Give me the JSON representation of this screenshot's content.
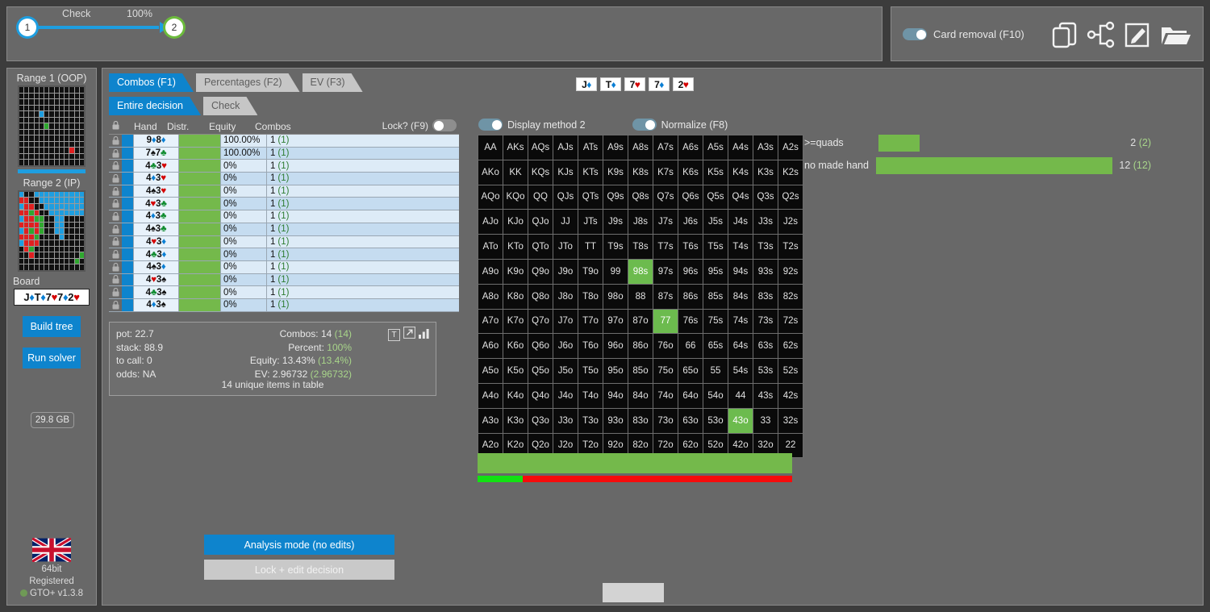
{
  "tree": {
    "node1": "1",
    "node2": "2",
    "action_label": "Check",
    "action_pct": "100%"
  },
  "top_right": {
    "card_removal_label": "Card removal (F10)",
    "card_removal_on": true,
    "icons": [
      "copy-cards-icon",
      "tree-nodes-icon",
      "edit-icon",
      "folder-open-icon"
    ]
  },
  "sidebar": {
    "range1_label": "Range 1 (OOP)",
    "range2_label": "Range 2 (IP)",
    "board_label": "Board",
    "board_value": "J♦T♦7♥7♦2♥",
    "build_tree_label": "Build tree",
    "run_solver_label": "Run solver",
    "memory": "29.8 GB",
    "bits": "64bit",
    "registration": "Registered",
    "version": "GTO+ v1.3.8"
  },
  "tabs_primary": [
    {
      "label": "Combos (F1)",
      "active": true
    },
    {
      "label": "Percentages (F2)",
      "active": false
    },
    {
      "label": "EV (F3)",
      "active": false
    }
  ],
  "tabs_secondary": [
    {
      "label": "Entire decision",
      "active": true
    },
    {
      "label": "Check",
      "active": false
    }
  ],
  "board_cards": [
    {
      "rank": "J",
      "suit": "♦",
      "color": "#0b7fd4"
    },
    {
      "rank": "T",
      "suit": "♦",
      "color": "#0b7fd4"
    },
    {
      "rank": "7",
      "suit": "♥",
      "color": "#d40000"
    },
    {
      "rank": "7",
      "suit": "♦",
      "color": "#0b7fd4"
    },
    {
      "rank": "2",
      "suit": "♥",
      "color": "#d40000"
    }
  ],
  "hand_table": {
    "headers": {
      "hand": "Hand",
      "distr": "Distr.",
      "equity": "Equity",
      "combos": "Combos",
      "lock": "Lock? (F9)"
    },
    "lock_on": false,
    "rows": [
      {
        "hand": "9♦8♦",
        "equity": "100.00%",
        "combos": "1",
        "combos_paren": "(1)"
      },
      {
        "hand": "7♠7♣",
        "equity": "100.00%",
        "combos": "1",
        "combos_paren": "(1)"
      },
      {
        "hand": "4♣3♥",
        "equity": "0%",
        "combos": "1",
        "combos_paren": "(1)"
      },
      {
        "hand": "4♦3♥",
        "equity": "0%",
        "combos": "1",
        "combos_paren": "(1)"
      },
      {
        "hand": "4♠3♥",
        "equity": "0%",
        "combos": "1",
        "combos_paren": "(1)"
      },
      {
        "hand": "4♥3♣",
        "equity": "0%",
        "combos": "1",
        "combos_paren": "(1)"
      },
      {
        "hand": "4♦3♣",
        "equity": "0%",
        "combos": "1",
        "combos_paren": "(1)"
      },
      {
        "hand": "4♠3♣",
        "equity": "0%",
        "combos": "1",
        "combos_paren": "(1)"
      },
      {
        "hand": "4♥3♦",
        "equity": "0%",
        "combos": "1",
        "combos_paren": "(1)"
      },
      {
        "hand": "4♣3♦",
        "equity": "0%",
        "combos": "1",
        "combos_paren": "(1)"
      },
      {
        "hand": "4♠3♦",
        "equity": "0%",
        "combos": "1",
        "combos_paren": "(1)"
      },
      {
        "hand": "4♥3♠",
        "equity": "0%",
        "combos": "1",
        "combos_paren": "(1)"
      },
      {
        "hand": "4♣3♠",
        "equity": "0%",
        "combos": "1",
        "combos_paren": "(1)"
      },
      {
        "hand": "4♦3♠",
        "equity": "0%",
        "combos": "1",
        "combos_paren": "(1)"
      }
    ]
  },
  "info": {
    "pot_label": "pot:",
    "pot_value": "22.7",
    "stack_label": "stack:",
    "stack_value": "88.9",
    "tocall_label": "to call:",
    "tocall_value": "0",
    "odds_label": "odds:",
    "odds_value": "NA",
    "combos_label": "Combos:",
    "combos_value": "14",
    "combos_paren": "(14)",
    "percent_label": "Percent:",
    "percent_value": "100%",
    "equity_label": "Equity:",
    "equity_value": "13.43%",
    "equity_paren": "(13.4%)",
    "ev_label": "EV:",
    "ev_value": "2.96732",
    "ev_paren": "(2.96732)",
    "note": "14 unique items in table"
  },
  "matrix_toggles": {
    "display_method_label": "Display method 2",
    "display_method_on": true,
    "normalize_label": "Normalize (F8)",
    "normalize_on": true
  },
  "matrix": {
    "highlight_color": "#6cbb4e",
    "highlighted": [
      "98s",
      "77",
      "43o"
    ],
    "cells": [
      [
        "AA",
        "AKs",
        "AQs",
        "AJs",
        "ATs",
        "A9s",
        "A8s",
        "A7s",
        "A6s",
        "A5s",
        "A4s",
        "A3s",
        "A2s"
      ],
      [
        "AKo",
        "KK",
        "KQs",
        "KJs",
        "KTs",
        "K9s",
        "K8s",
        "K7s",
        "K6s",
        "K5s",
        "K4s",
        "K3s",
        "K2s"
      ],
      [
        "AQo",
        "KQo",
        "QQ",
        "QJs",
        "QTs",
        "Q9s",
        "Q8s",
        "Q7s",
        "Q6s",
        "Q5s",
        "Q4s",
        "Q3s",
        "Q2s"
      ],
      [
        "AJo",
        "KJo",
        "QJo",
        "JJ",
        "JTs",
        "J9s",
        "J8s",
        "J7s",
        "J6s",
        "J5s",
        "J4s",
        "J3s",
        "J2s"
      ],
      [
        "ATo",
        "KTo",
        "QTo",
        "JTo",
        "TT",
        "T9s",
        "T8s",
        "T7s",
        "T6s",
        "T5s",
        "T4s",
        "T3s",
        "T2s"
      ],
      [
        "A9o",
        "K9o",
        "Q9o",
        "J9o",
        "T9o",
        "99",
        "98s",
        "97s",
        "96s",
        "95s",
        "94s",
        "93s",
        "92s"
      ],
      [
        "A8o",
        "K8o",
        "Q8o",
        "J8o",
        "T8o",
        "98o",
        "88",
        "87s",
        "86s",
        "85s",
        "84s",
        "83s",
        "82s"
      ],
      [
        "A7o",
        "K7o",
        "Q7o",
        "J7o",
        "T7o",
        "97o",
        "87o",
        "77",
        "76s",
        "75s",
        "74s",
        "73s",
        "72s"
      ],
      [
        "A6o",
        "K6o",
        "Q6o",
        "J6o",
        "T6o",
        "96o",
        "86o",
        "76o",
        "66",
        "65s",
        "64s",
        "63s",
        "62s"
      ],
      [
        "A5o",
        "K5o",
        "Q5o",
        "J5o",
        "T5o",
        "95o",
        "85o",
        "75o",
        "65o",
        "55",
        "54s",
        "53s",
        "52s"
      ],
      [
        "A4o",
        "K4o",
        "Q4o",
        "J4o",
        "T4o",
        "94o",
        "84o",
        "74o",
        "64o",
        "54o",
        "44",
        "43s",
        "42s"
      ],
      [
        "A3o",
        "K3o",
        "Q3o",
        "J3o",
        "T3o",
        "93o",
        "83o",
        "73o",
        "63o",
        "53o",
        "43o",
        "33",
        "32s"
      ],
      [
        "A2o",
        "K2o",
        "Q2o",
        "J2o",
        "T2o",
        "92o",
        "82o",
        "72o",
        "62o",
        "52o",
        "42o",
        "32o",
        "22"
      ]
    ]
  },
  "summary_bars": {
    "big_bar_pct": 100,
    "thin_green_pct": 14.3,
    "thin_red_pct": 85.7
  },
  "categories": [
    {
      "label": ">=quads",
      "bar_pct": 16.7,
      "count": "2",
      "count_paren": "(2)"
    },
    {
      "label": "no made hand",
      "bar_pct": 100,
      "count": "12",
      "count_paren": "(12)"
    }
  ],
  "bottom_buttons": {
    "analysis_mode": "Analysis mode (no edits)",
    "lock_edit": "Lock + edit decision"
  }
}
